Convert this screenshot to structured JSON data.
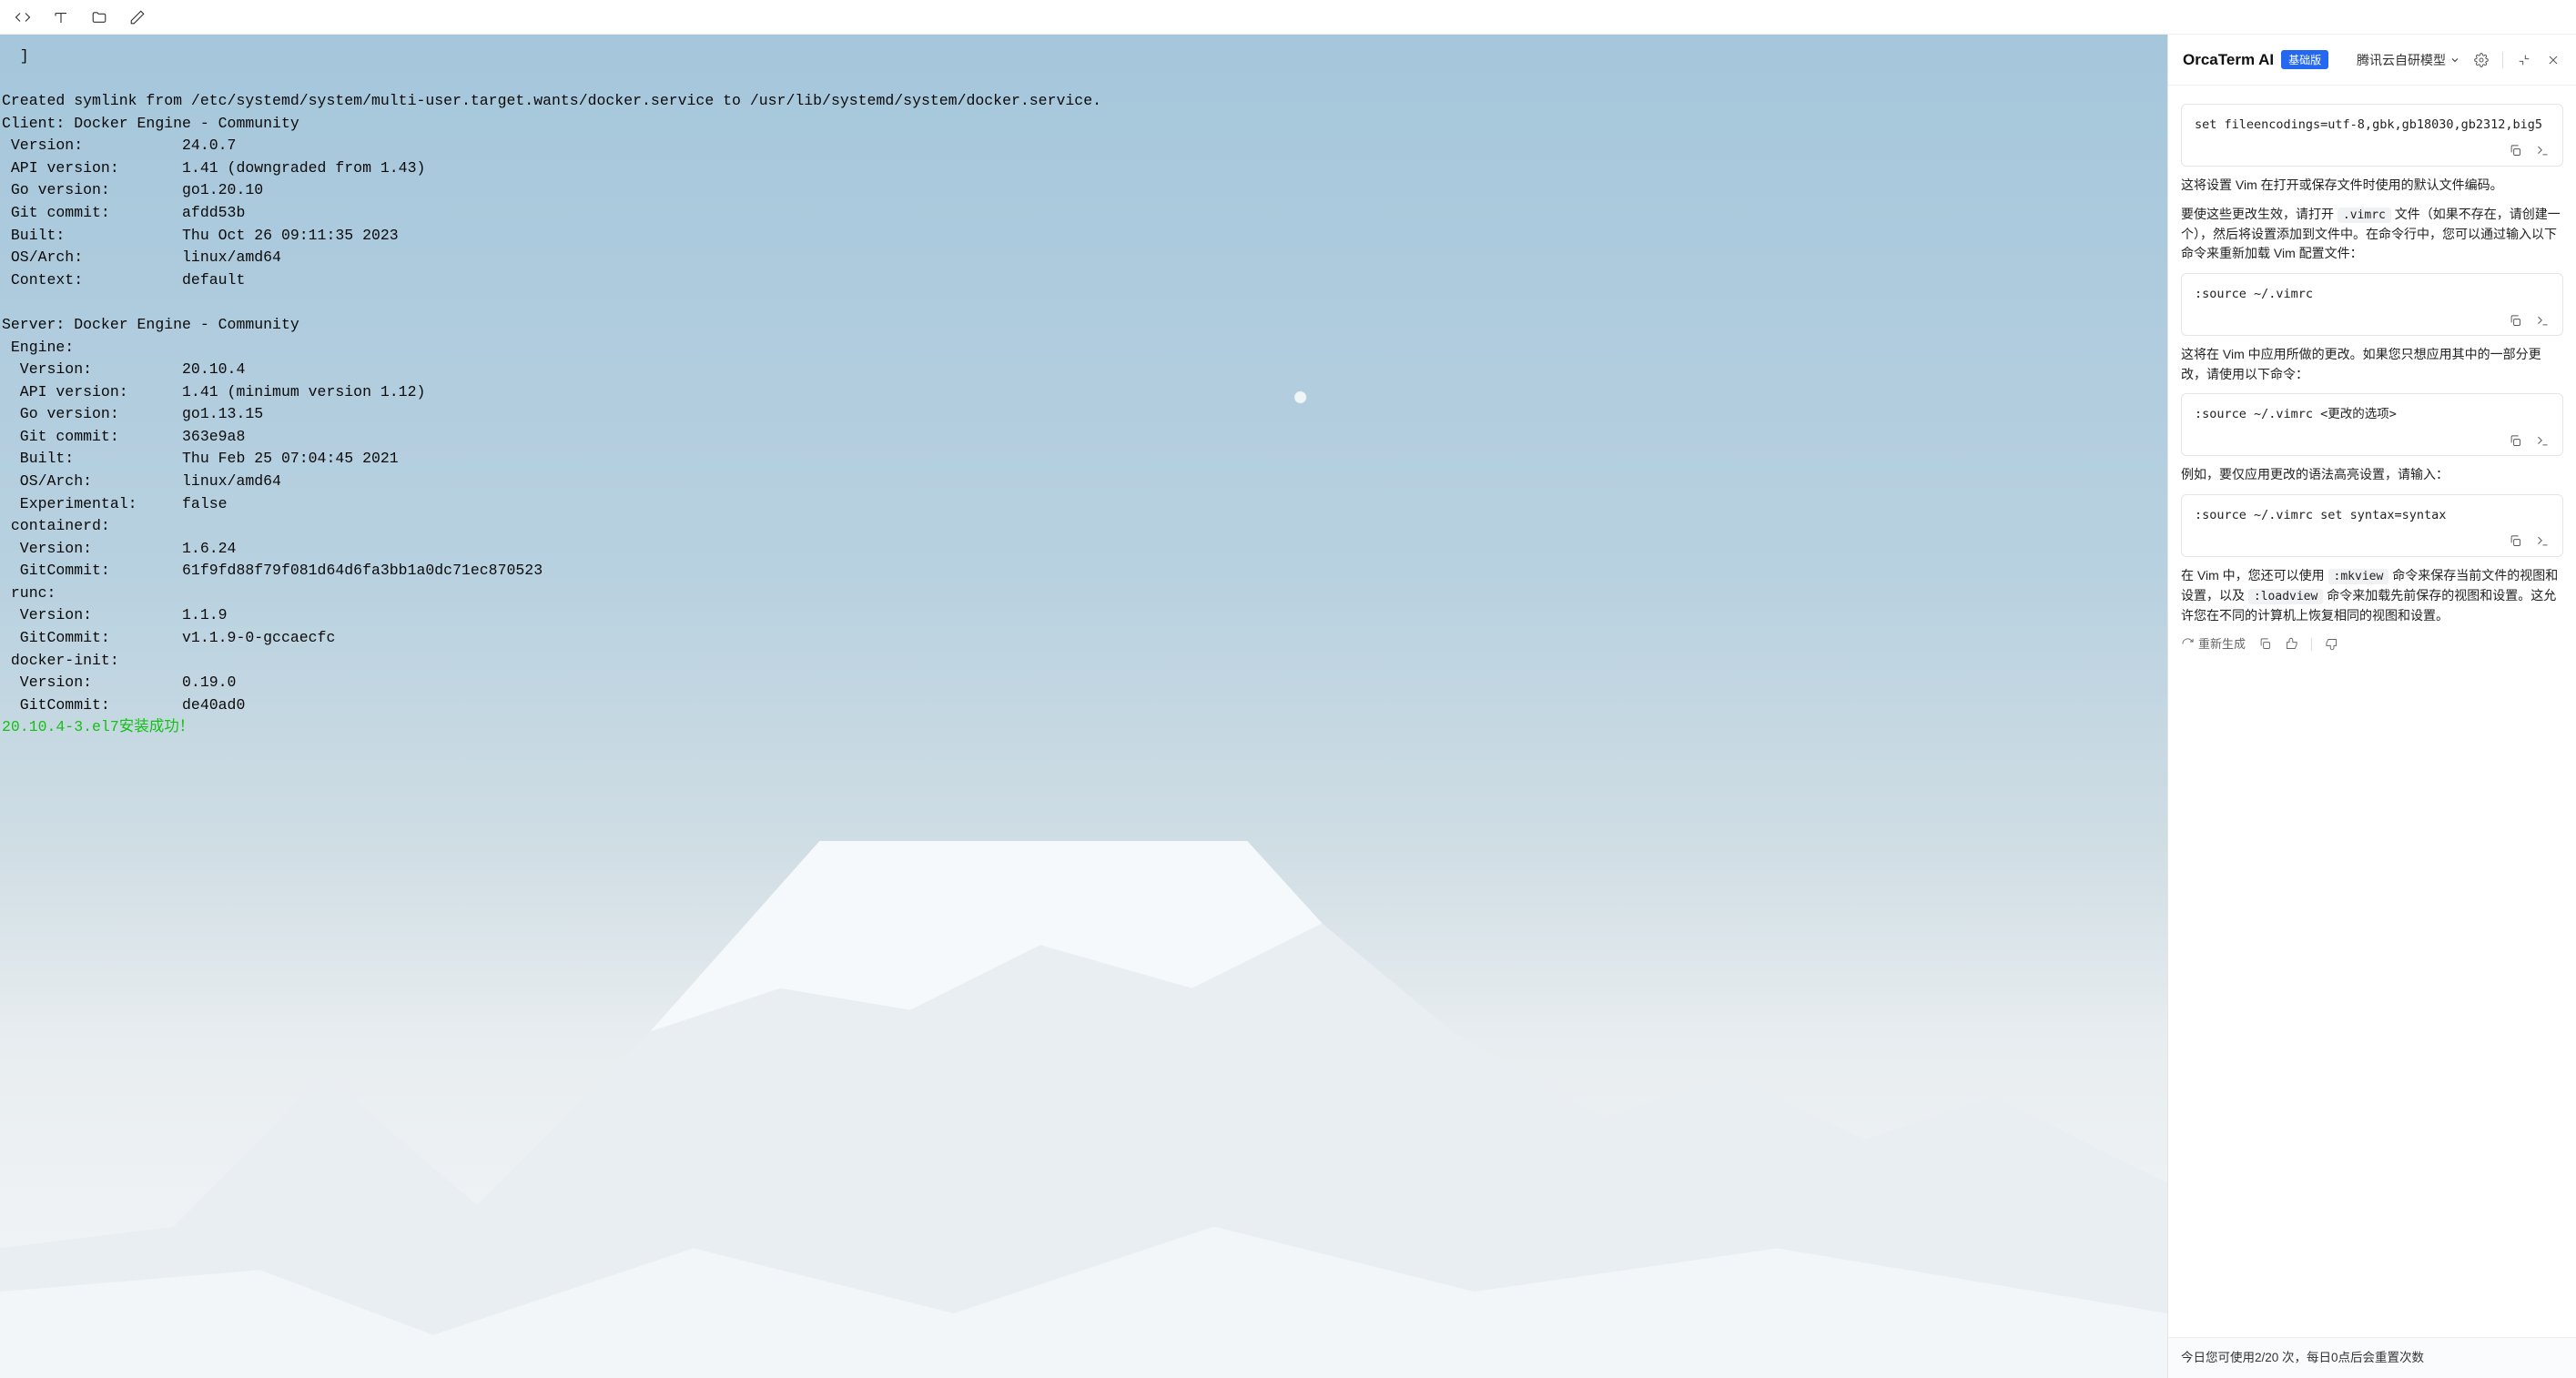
{
  "toolbar": {
    "icons": [
      "code-icon",
      "format-icon",
      "folder-icon",
      "edit-icon"
    ]
  },
  "terminal": {
    "lines": [
      "  ]",
      "",
      "Created symlink from /etc/systemd/system/multi-user.target.wants/docker.service to /usr/lib/systemd/system/docker.service.",
      "Client: Docker Engine - Community",
      " Version:           24.0.7",
      " API version:       1.41 (downgraded from 1.43)",
      " Go version:        go1.20.10",
      " Git commit:        afdd53b",
      " Built:             Thu Oct 26 09:11:35 2023",
      " OS/Arch:           linux/amd64",
      " Context:           default",
      "",
      "Server: Docker Engine - Community",
      " Engine:",
      "  Version:          20.10.4",
      "  API version:      1.41 (minimum version 1.12)",
      "  Go version:       go1.13.15",
      "  Git commit:       363e9a8",
      "  Built:            Thu Feb 25 07:04:45 2021",
      "  OS/Arch:          linux/amd64",
      "  Experimental:     false",
      " containerd:",
      "  Version:          1.6.24",
      "  GitCommit:        61f9fd88f79f081d64d6fa3bb1a0dc71ec870523",
      " runc:",
      "  Version:          1.1.9",
      "  GitCommit:        v1.1.9-0-gccaecfc",
      " docker-init:",
      "  Version:          0.19.0",
      "  GitCommit:        de40ad0"
    ],
    "success_line": "20.10.4-3.el7安装成功！"
  },
  "ai": {
    "title": "OrcaTerm AI",
    "badge": "基础版",
    "model": "腾讯云自研模型",
    "codes": [
      "set fileencodings=utf-8,gbk,gb18030,gb2312,big5",
      ":source ~/.vimrc",
      ":source ~/.vimrc <更改的选项>",
      ":source ~/.vimrc set syntax=syntax"
    ],
    "para1_a": "这将设置 Vim 在打开或保存文件时使用的默认文件编码。",
    "para1_b_pre": "要使这些更改生效，请打开 ",
    "para1_b_code": ".vimrc",
    "para1_b_post": " 文件（如果不存在，请创建一个），然后将设置添加到文件中。在命令行中，您可以通过输入以下命令来重新加载 Vim 配置文件：",
    "para2": "这将在 Vim 中应用所做的更改。如果您只想应用其中的一部分更改，请使用以下命令：",
    "para3": "例如，要仅应用更改的语法高亮设置，请输入：",
    "para4_pre": "在 Vim 中，您还可以使用 ",
    "para4_c1": ":mkview",
    "para4_mid": " 命令来保存当前文件的视图和设置，以及 ",
    "para4_c2": ":loadview",
    "para4_post": " 命令来加载先前保存的视图和设置。这允许您在不同的计算机上恢复相同的视图和设置。",
    "regenerate": "重新生成",
    "usage": "今日您可使用2/20 次，每日0点后会重置次数"
  }
}
